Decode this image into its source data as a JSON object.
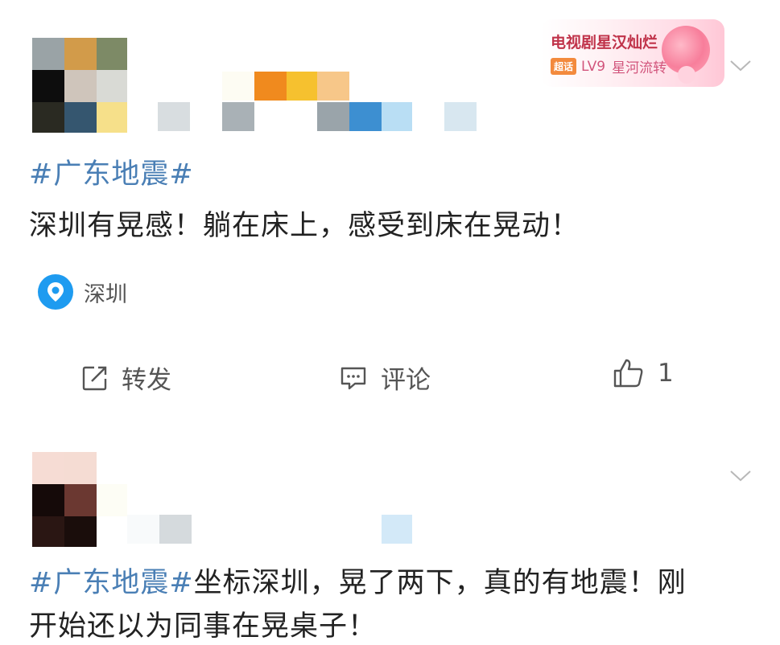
{
  "post1": {
    "hashtag": "#广东地震#",
    "text": "深圳有晃感！躺在床上，感受到床在晃动！",
    "location": "深圳",
    "badge": {
      "title": "电视剧星汉灿烂",
      "chip": "超话",
      "level": "LV9",
      "rank": "星河流转"
    },
    "actions": {
      "repost_label": "转发",
      "comment_label": "评论",
      "like_count": "1"
    }
  },
  "post2": {
    "hashtag": "#广东地震#",
    "text_line1": "坐标深圳，晃了两下，真的有地震！刚",
    "text_line2": "开始还以为同事在晃桌子！"
  },
  "icons": {
    "repost": "share-icon",
    "comment": "comment-icon",
    "like": "thumbs-up-icon",
    "location": "location-pin-icon",
    "more": "chevron-down-icon"
  },
  "colors": {
    "hashtag": "#4a7fb5",
    "location_pin": "#1e9bf0"
  }
}
